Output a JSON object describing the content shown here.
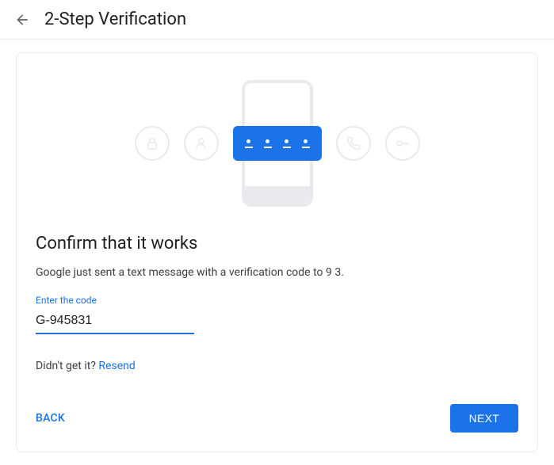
{
  "header": {
    "title": "2-Step Verification"
  },
  "main": {
    "heading": "Confirm that it works",
    "description": "Google just sent a text message with a verification code to 9              3.",
    "input_label": "Enter the code",
    "input_value": "G-945831",
    "resend_prompt": "Didn't get it? ",
    "resend_link": "Resend"
  },
  "buttons": {
    "back": "BACK",
    "next": "NEXT"
  }
}
